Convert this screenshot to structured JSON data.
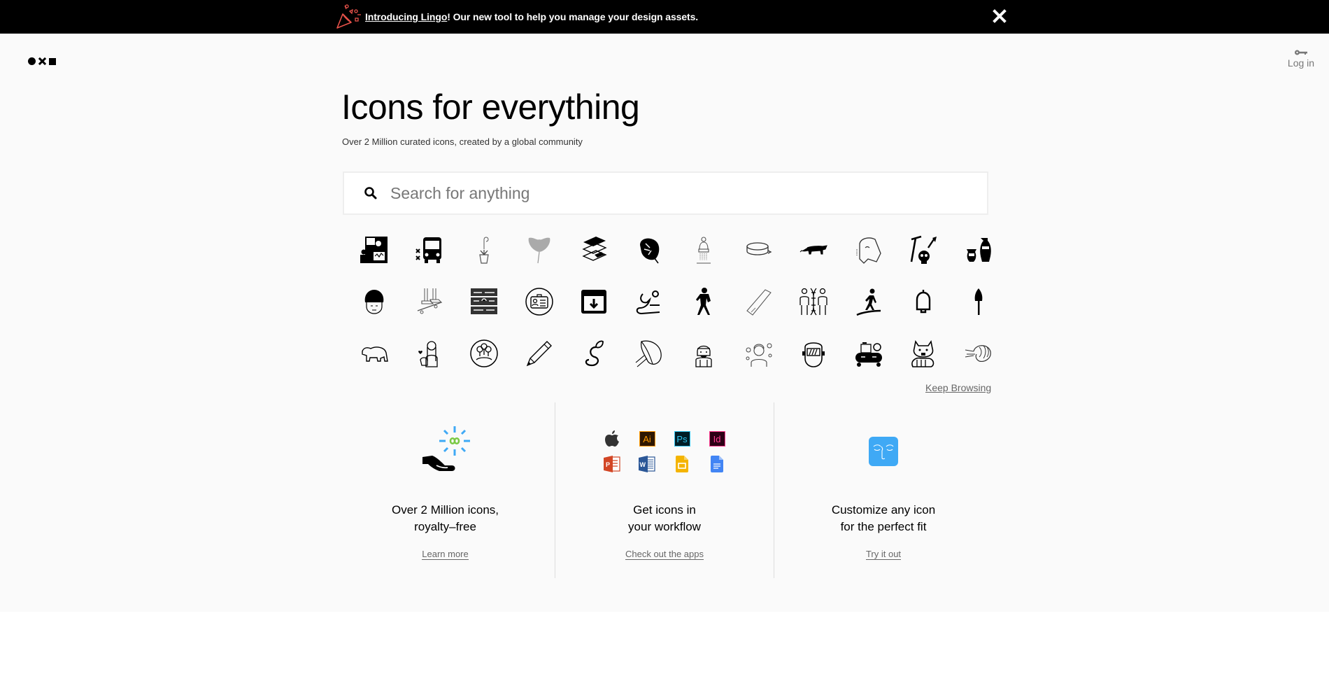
{
  "banner": {
    "link_text": "Introducing Lingo",
    "text": "! Our new tool to help you manage your design assets.",
    "icon": "party-popper-icon",
    "close_icon": "close-icon",
    "accent_color": "#e8524a"
  },
  "header": {
    "logo": "noun-project-logo",
    "login_label": "Log in",
    "login_icon": "key-icon"
  },
  "hero": {
    "title": "Icons for everything",
    "subtitle": "Over 2 Million curated icons, created by a global community"
  },
  "search": {
    "placeholder": "Search for anything",
    "value": "",
    "icon": "search-icon"
  },
  "icon_grid": {
    "rows": [
      [
        "broadcast-presenter",
        "bus",
        "hanging-plant",
        "ginkgo-leaf",
        "layers-stack",
        "monstera-leaf",
        "shower-statue",
        "round-box",
        "leopard",
        "head-profile",
        "archaeology-tools",
        "vases"
      ],
      [
        "helmet-face",
        "skateboard-feet",
        "maze",
        "id-badge",
        "archive-box",
        "yoga-stretch",
        "football-player",
        "tape-roll",
        "dna-people",
        "snowshoe-walker",
        "bell",
        "shovel"
      ],
      [
        "bear",
        "vet-with-dog",
        "forest-compass",
        "pencil",
        "seedling-swirl",
        "big-leaf",
        "beekeeper",
        "woman-with-flowers",
        "welding-mask",
        "air-compressor",
        "red-panda",
        "shrimp"
      ]
    ]
  },
  "keep_browsing": "Keep Browsing",
  "features": [
    {
      "title": "Over 2 Million icons,\nroyalty–free",
      "link": "Learn more",
      "icon": "hand-infinity-icon",
      "colors": {
        "rays": "#3fa9f5",
        "infinity": "#7ac943"
      }
    },
    {
      "title": "Get icons in\nyour workflow",
      "link": "Check out the apps",
      "apps": [
        {
          "name": "apple-icon",
          "label": "",
          "bg": "#333333",
          "fg": "#333333"
        },
        {
          "name": "illustrator-icon",
          "label": "Ai",
          "bg": "#2e1700",
          "fg": "#ff9a00"
        },
        {
          "name": "photoshop-icon",
          "label": "Ps",
          "bg": "#001d26",
          "fg": "#31c5f0"
        },
        {
          "name": "indesign-icon",
          "label": "Id",
          "bg": "#2d0016",
          "fg": "#ff3d90"
        },
        {
          "name": "powerpoint-icon",
          "label": "P",
          "bg": "#d24625",
          "fg": "#ffffff"
        },
        {
          "name": "word-icon",
          "label": "W",
          "bg": "#2b5797",
          "fg": "#ffffff"
        },
        {
          "name": "google-slides-icon",
          "label": "",
          "bg": "#f4b400",
          "fg": "#ffffff"
        },
        {
          "name": "google-docs-icon",
          "label": "",
          "bg": "#4285f4",
          "fg": "#ffffff"
        }
      ]
    },
    {
      "title": "Customize any icon\nfor the perfect fit",
      "link": "Try it out",
      "icon": "face-customize-icon",
      "colors": {
        "tile": "#3fa9f5"
      }
    }
  ]
}
